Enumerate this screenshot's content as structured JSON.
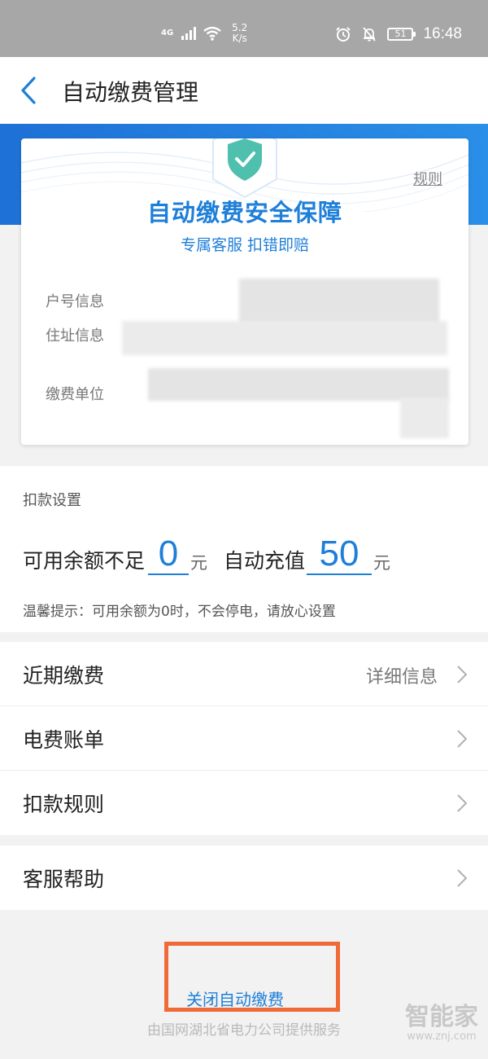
{
  "status_bar": {
    "network": "4G",
    "speed_value": "5.2",
    "speed_unit": "K/s",
    "battery": "51",
    "time": "16:48"
  },
  "header": {
    "title": "自动缴费管理"
  },
  "guarantee_card": {
    "rules_link": "规则",
    "title": "自动缴费安全保障",
    "subtitle": "专属客服 扣错即赔",
    "fields": [
      {
        "label": "户号信息"
      },
      {
        "label": "住址信息"
      },
      {
        "label": "缴费单位"
      }
    ]
  },
  "deduction": {
    "heading": "扣款设置",
    "threshold_label": "可用余额不足",
    "threshold_value": "0",
    "threshold_unit": "元",
    "recharge_label": "自动充值",
    "recharge_value": "50",
    "recharge_unit": "元",
    "tip": "温馨提示：可用余额为0时，不会停电，请放心设置"
  },
  "menu": {
    "recent": {
      "label": "近期缴费",
      "extra": "详细信息"
    },
    "bill": {
      "label": "电费账单"
    },
    "rules": {
      "label": "扣款规则"
    },
    "help": {
      "label": "客服帮助"
    }
  },
  "close_button": {
    "label": "关闭自动缴费"
  },
  "footer": {
    "text": "由国网湖北省电力公司提供服务"
  },
  "watermark": {
    "name": "智能家",
    "url": "www.znj.com"
  },
  "colors": {
    "accent": "#1e7fd8",
    "banner": "#1e71d6",
    "highlight_border": "#f06a38",
    "shield": "#4fbfae"
  },
  "icons": {
    "back": "chevron-left-icon",
    "signal": "signal-icon",
    "wifi": "wifi-icon",
    "alarm": "alarm-icon",
    "mute": "bell-off-icon",
    "battery": "battery-icon",
    "shield": "shield-check-icon",
    "row_arrow": "chevron-right-icon"
  }
}
